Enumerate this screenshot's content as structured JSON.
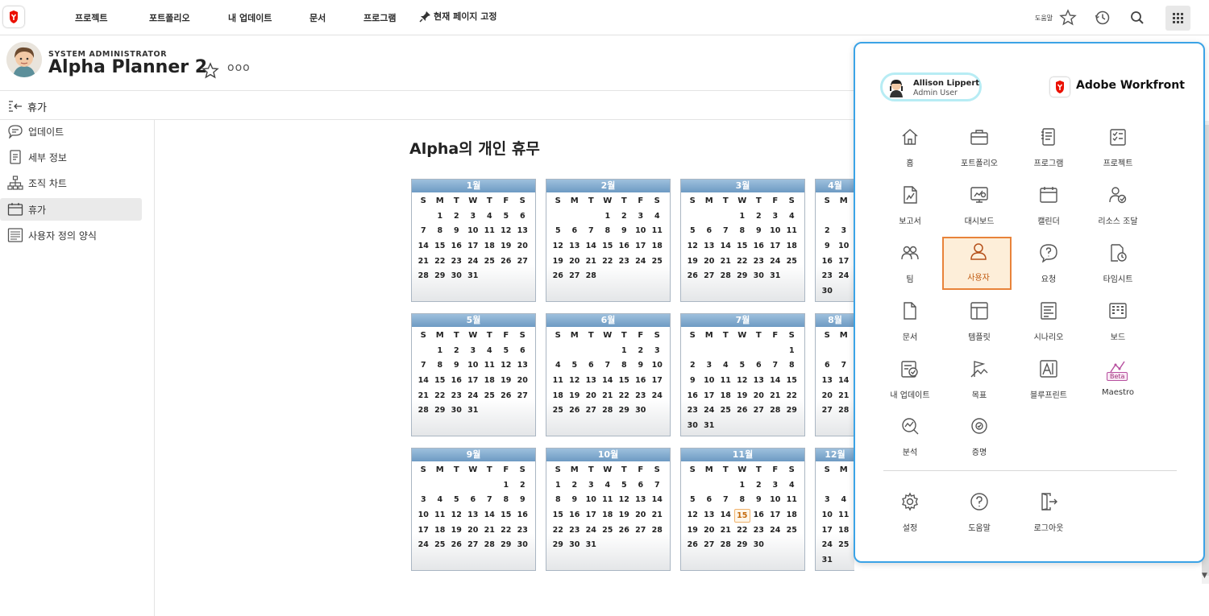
{
  "topnav": {
    "items": [
      "프로젝트",
      "포트폴리오",
      "내 업데이트",
      "문서",
      "프로그램"
    ],
    "pin_label": "현재 페이지 고정",
    "help_label": "도움말"
  },
  "header": {
    "role": "SYSTEM ADMINISTRATOR",
    "name": "Alpha Planner 2",
    "more": "ooo"
  },
  "section": {
    "title": "휴가"
  },
  "sidebar": {
    "items": [
      {
        "label": "업데이트",
        "icon": "speech-bubble-icon"
      },
      {
        "label": "세부 정보",
        "icon": "document-icon"
      },
      {
        "label": "조직 차트",
        "icon": "org-chart-icon"
      },
      {
        "label": "휴가",
        "icon": "calendar-icon",
        "active": true
      },
      {
        "label": "사용자 정의 양식",
        "icon": "form-icon"
      }
    ]
  },
  "calendar": {
    "title": "Alpha의 개인 휴무",
    "weekdays": [
      "S",
      "M",
      "T",
      "W",
      "T",
      "F",
      "S"
    ],
    "today": {
      "month": 11,
      "day": 15
    },
    "months": [
      {
        "label": "1월",
        "offset": 1,
        "days": 31,
        "visible_cols": 7
      },
      {
        "label": "2월",
        "offset": 3,
        "days": 28,
        "visible_cols": 7
      },
      {
        "label": "3월",
        "offset": 3,
        "days": 31,
        "visible_cols": 7
      },
      {
        "label": "4월",
        "offset": 6,
        "days": 30,
        "visible_cols": 2
      },
      {
        "label": "5월",
        "offset": 1,
        "days": 31,
        "visible_cols": 7
      },
      {
        "label": "6월",
        "offset": 4,
        "days": 30,
        "visible_cols": 7
      },
      {
        "label": "7월",
        "offset": 6,
        "days": 31,
        "visible_cols": 7
      },
      {
        "label": "8월",
        "offset": 2,
        "days": 31,
        "visible_cols": 2
      },
      {
        "label": "9월",
        "offset": 5,
        "days": 30,
        "visible_cols": 7
      },
      {
        "label": "10월",
        "offset": 0,
        "days": 31,
        "visible_cols": 7
      },
      {
        "label": "11월",
        "offset": 3,
        "days": 30,
        "visible_cols": 7
      },
      {
        "label": "12월",
        "offset": 5,
        "days": 31,
        "visible_cols": 2
      }
    ]
  },
  "launcher": {
    "user": {
      "name": "Allison Lippert",
      "role": "Admin User"
    },
    "brand": "Adobe Workfront",
    "apps": [
      {
        "label": "홈",
        "icon": "home-icon"
      },
      {
        "label": "포트폴리오",
        "icon": "portfolio-icon"
      },
      {
        "label": "프로그램",
        "icon": "program-icon"
      },
      {
        "label": "프로젝트",
        "icon": "project-icon"
      },
      {
        "label": "보고서",
        "icon": "report-icon"
      },
      {
        "label": "대시보드",
        "icon": "dashboard-icon"
      },
      {
        "label": "캘린더",
        "icon": "calendar-icon"
      },
      {
        "label": "리소스 조달",
        "icon": "resourcing-icon"
      },
      {
        "label": "팀",
        "icon": "team-icon"
      },
      {
        "label": "사용자",
        "icon": "user-icon",
        "selected": true
      },
      {
        "label": "요청",
        "icon": "request-icon"
      },
      {
        "label": "타임시트",
        "icon": "timesheet-icon"
      },
      {
        "label": "문서",
        "icon": "document-icon"
      },
      {
        "label": "템플릿",
        "icon": "template-icon"
      },
      {
        "label": "시나리오",
        "icon": "scenario-icon"
      },
      {
        "label": "보드",
        "icon": "board-icon"
      },
      {
        "label": "내 업데이트",
        "icon": "updates-icon"
      },
      {
        "label": "목표",
        "icon": "goal-icon"
      },
      {
        "label": "블루프린트",
        "icon": "blueprint-icon"
      },
      {
        "label": "Maestro",
        "icon": "maestro-icon",
        "badge": "Beta"
      },
      {
        "label": "분석",
        "icon": "analytics-icon"
      },
      {
        "label": "증명",
        "icon": "proof-icon"
      }
    ],
    "footer": [
      {
        "label": "설정",
        "icon": "gear-icon"
      },
      {
        "label": "도움말",
        "icon": "help-icon"
      },
      {
        "label": "로그아웃",
        "icon": "logout-icon"
      }
    ]
  },
  "colors": {
    "accent": "#3ba3e6",
    "selected": "#e8833a",
    "brand": "#eb1000"
  }
}
